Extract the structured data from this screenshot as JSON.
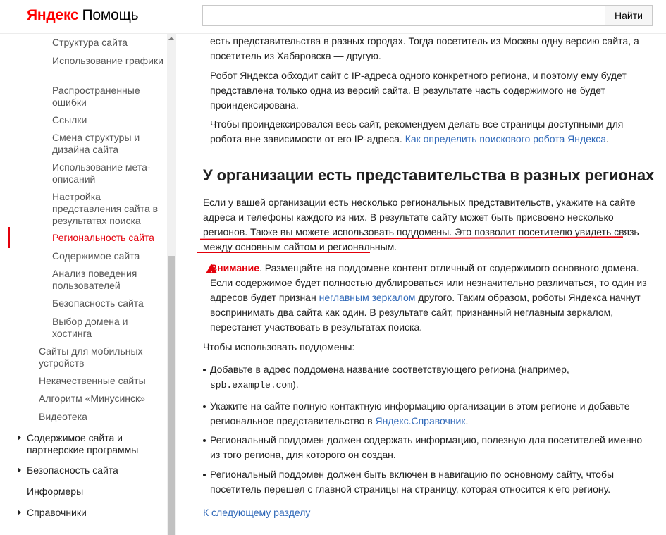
{
  "header": {
    "logo_brand": "Яндекс",
    "logo_product": "Помощь",
    "search_placeholder": "",
    "search_button": "Найти"
  },
  "sidebar": {
    "items": [
      {
        "label": "Структура сайта",
        "level": 3
      },
      {
        "label": "Использование графики",
        "level": 3
      },
      {
        "label": "Распространенные ошибки",
        "level": 3
      },
      {
        "label": "Ссылки",
        "level": 3
      },
      {
        "label": "Смена структуры и дизайна сайта",
        "level": 3
      },
      {
        "label": "Использование мета-описаний",
        "level": 3
      },
      {
        "label": "Настройка представления сайта в результатах поиска",
        "level": 3
      },
      {
        "label": "Региональность сайта",
        "level": 3,
        "active": true
      },
      {
        "label": "Содержимое сайта",
        "level": 3
      },
      {
        "label": "Анализ поведения пользователей",
        "level": 3
      },
      {
        "label": "Безопасность сайта",
        "level": 3
      },
      {
        "label": "Выбор домена и хостинга",
        "level": 3
      },
      {
        "label": "Сайты для мобильных устройств",
        "level": 2
      },
      {
        "label": "Некачественные сайты",
        "level": 2
      },
      {
        "label": "Алгоритм «Минусинск»",
        "level": 2
      },
      {
        "label": "Видеотека",
        "level": 2
      },
      {
        "label": "Содержимое сайта и партнерские программы",
        "level": 1,
        "bullet": true
      },
      {
        "label": "Безопасность сайта",
        "level": 1,
        "bullet": true
      },
      {
        "label": "Информеры",
        "level": 1
      },
      {
        "label": "Справочники",
        "level": 1,
        "bullet": true
      }
    ]
  },
  "content": {
    "p_top": "есть представительства в разных городах. Тогда посетитель из Москвы одну версию сайта, а посетитель из Хабаровска — другую.",
    "p_robot": "Робот Яндекса обходит сайт с IP-адреса одного конкретного региона, и поэтому ему будет представлена только одна из версий сайта. В результате часть содержимого не будет проиндексирована.",
    "p_index_text": "Чтобы проиндексировался весь сайт, рекомендуем делать все страницы доступными для робота вне зависимости от его IP-адреса. ",
    "p_index_link": "Как определить поискового робота Яндекса",
    "p_index_end": ".",
    "heading": "У организации есть представительства в разных регионах",
    "p_org_1": "Если у вашей организации есть несколько региональных представительств, укажите на сайте адреса и телефоны каждого из них. В результате сайту может быть присвоено несколько регионов.",
    "p_org_2": "Также вы можете использовать поддомены. Это позволит посетителю увидеть связь между основным сайтом и региональным.",
    "warning_label": "Внимание",
    "warning_text_1": ". Размещайте на поддомене контент отличный от содержимого основного домена. Если содержимое будет полностью дублироваться или незначительно различаться, то один из адресов будет признан ",
    "warning_link": "неглавным зеркалом",
    "warning_text_2": " другого. Таким образом, роботы Яндекса начнут воспринимать два сайта как один. В результате сайт, признанный неглавным зеркалом, перестанет участвовать в результатах поиска.",
    "p_subdomains": "Чтобы использовать поддомены:",
    "list_1_text": "Добавьте в адрес поддомена название соответствующего региона (например, ",
    "list_1_code": "spb.example.com",
    "list_1_end": ").",
    "list_2_text": "Укажите на сайте полную контактную информацию организации в этом регионе и добавьте региональное представительство в ",
    "list_2_link": "Яндекс.Справочник",
    "list_2_end": ".",
    "list_3": "Региональный поддомен должен содержать информацию, полезную для посетителей именно из того региона, для которого он создан.",
    "list_4": "Региональный поддомен должен быть включен в навигацию по основному сайту, чтобы посетитель перешел с главной страницы на страницу, которая относится к его региону.",
    "next_link": "К следующему разделу"
  },
  "colors": {
    "accent": "#e3000b",
    "link": "#2f68b8",
    "text": "#222222"
  }
}
